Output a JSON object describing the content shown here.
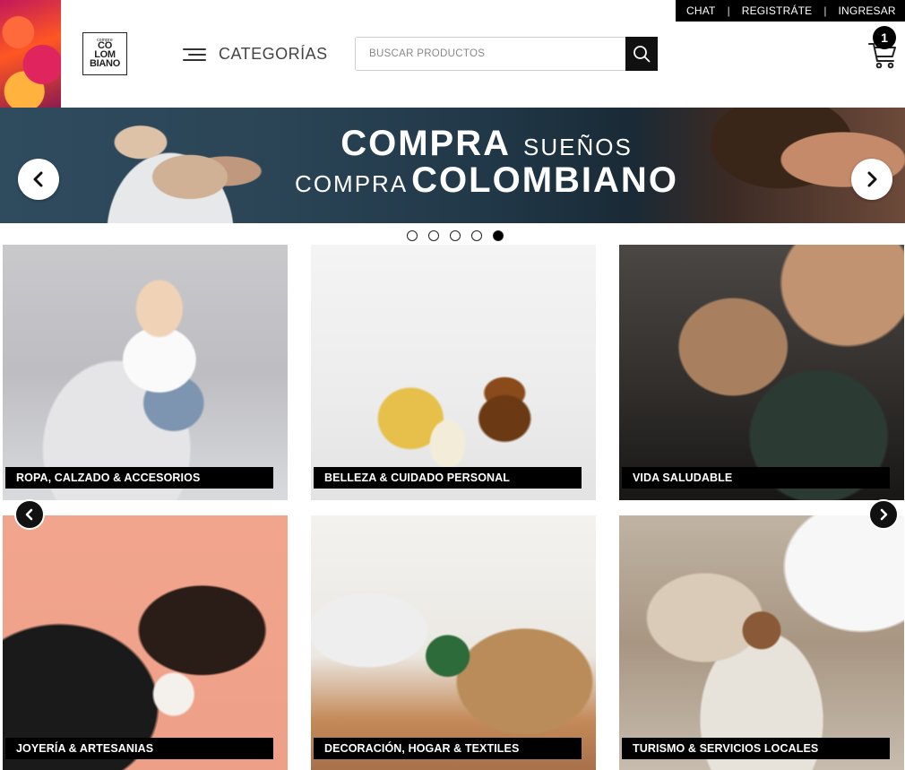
{
  "topbar": {
    "chat": "CHAT",
    "register": "REGISTRÁTE",
    "login": "INGRESAR",
    "separator": "|"
  },
  "logo": {
    "small": "compre",
    "line1": "CO",
    "line2": "LOM",
    "line3": "BIANO"
  },
  "menu": {
    "label": "CATEGORÍAS"
  },
  "search": {
    "placeholder": "BUSCAR PRODUCTOS",
    "value": ""
  },
  "cart": {
    "count": "1"
  },
  "banner": {
    "line1_bold": "COMPRA",
    "line1_light": "SUEÑOS",
    "line2_light": "COMPRA",
    "line2_bold": "COLOMBIANO",
    "slides_total": 5,
    "active_slide": 5
  },
  "categories": [
    {
      "label": "ROPA, CALZADO & ACCESORIOS"
    },
    {
      "label": "BELLEZA & CUIDADO PERSONAL"
    },
    {
      "label": "VIDA SALUDABLE"
    },
    {
      "label": "JOYERÍA & ARTESANIAS"
    },
    {
      "label": "DECORACIÓN, HOGAR & TEXTILES"
    },
    {
      "label": "TURISMO & SERVICIOS LOCALES"
    }
  ],
  "colors": {
    "accent": "#000000",
    "background": "#ffffff",
    "banner_bg": "#203747"
  },
  "icons": {
    "search": "search-icon",
    "cart": "cart-icon",
    "menu": "hamburger-icon",
    "prev": "chevron-left-icon",
    "next": "chevron-right-icon"
  }
}
